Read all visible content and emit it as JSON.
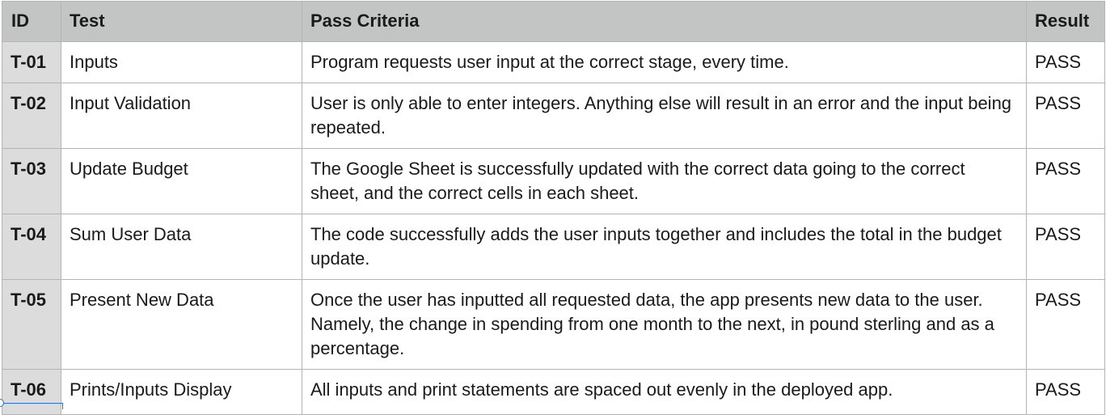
{
  "table": {
    "headers": {
      "id": "ID",
      "test": "Test",
      "criteria": "Pass Criteria",
      "result": "Result"
    },
    "rows": [
      {
        "id": "T-01",
        "test": "Inputs",
        "criteria": "Program requests user input at the correct stage, every time.",
        "result": "PASS"
      },
      {
        "id": "T-02",
        "test": "Input Validation",
        "criteria": "User is only able to enter integers. Anything else will result in an error and the input being repeated.",
        "result": "PASS"
      },
      {
        "id": "T-03",
        "test": "Update Budget",
        "criteria": "The Google Sheet is successfully updated with the correct data going to the correct sheet, and the correct cells in each sheet.",
        "result": "PASS"
      },
      {
        "id": "T-04",
        "test": "Sum User Data",
        "criteria": "The code successfully adds the user inputs together and includes the total in the budget update.",
        "result": "PASS"
      },
      {
        "id": "T-05",
        "test": "Present New Data",
        "criteria": "Once the user has inputted all requested data, the app presents new data to the user. Namely, the change in spending from one month to the next, in pound sterling and as a percentage.",
        "result": "PASS"
      },
      {
        "id": "T-06",
        "test": "Prints/Inputs Display",
        "criteria": "All inputs and print statements are spaced out evenly in the deployed app.",
        "result": "PASS"
      }
    ]
  },
  "colors": {
    "header_bg": "#c3c5c4",
    "id_column_bg": "#dcdcdc",
    "grid_line": "#b4b4b4",
    "selection_accent": "#2b6fd6"
  }
}
